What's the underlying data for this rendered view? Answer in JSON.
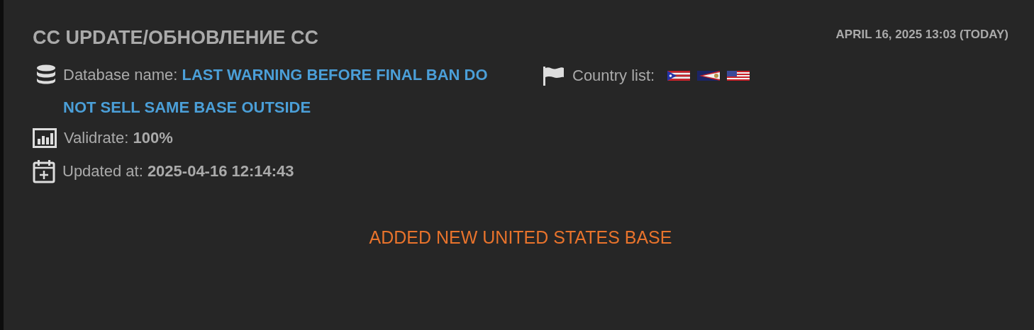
{
  "post": {
    "title": "CC UPDATE/ОБНОВЛЕНИЕ СС",
    "date": "APRIL 16, 2025 13:03 (TODAY)",
    "database": {
      "label": "Database name:",
      "value": "LAST WARNING BEFORE FINAL BAN DO NOT SELL SAME BASE OUTSIDE"
    },
    "countries": {
      "label": "Country list:",
      "flags": [
        {
          "kind": "pr"
        },
        {
          "kind": "as"
        },
        {
          "kind": "us"
        }
      ]
    },
    "validrate": {
      "label": "Validrate:",
      "value": "100%"
    },
    "updated": {
      "label": "Updated at:",
      "value": "2025-04-16 12:14:43"
    },
    "message": "ADDED NEW UNITED STATES BASE"
  }
}
